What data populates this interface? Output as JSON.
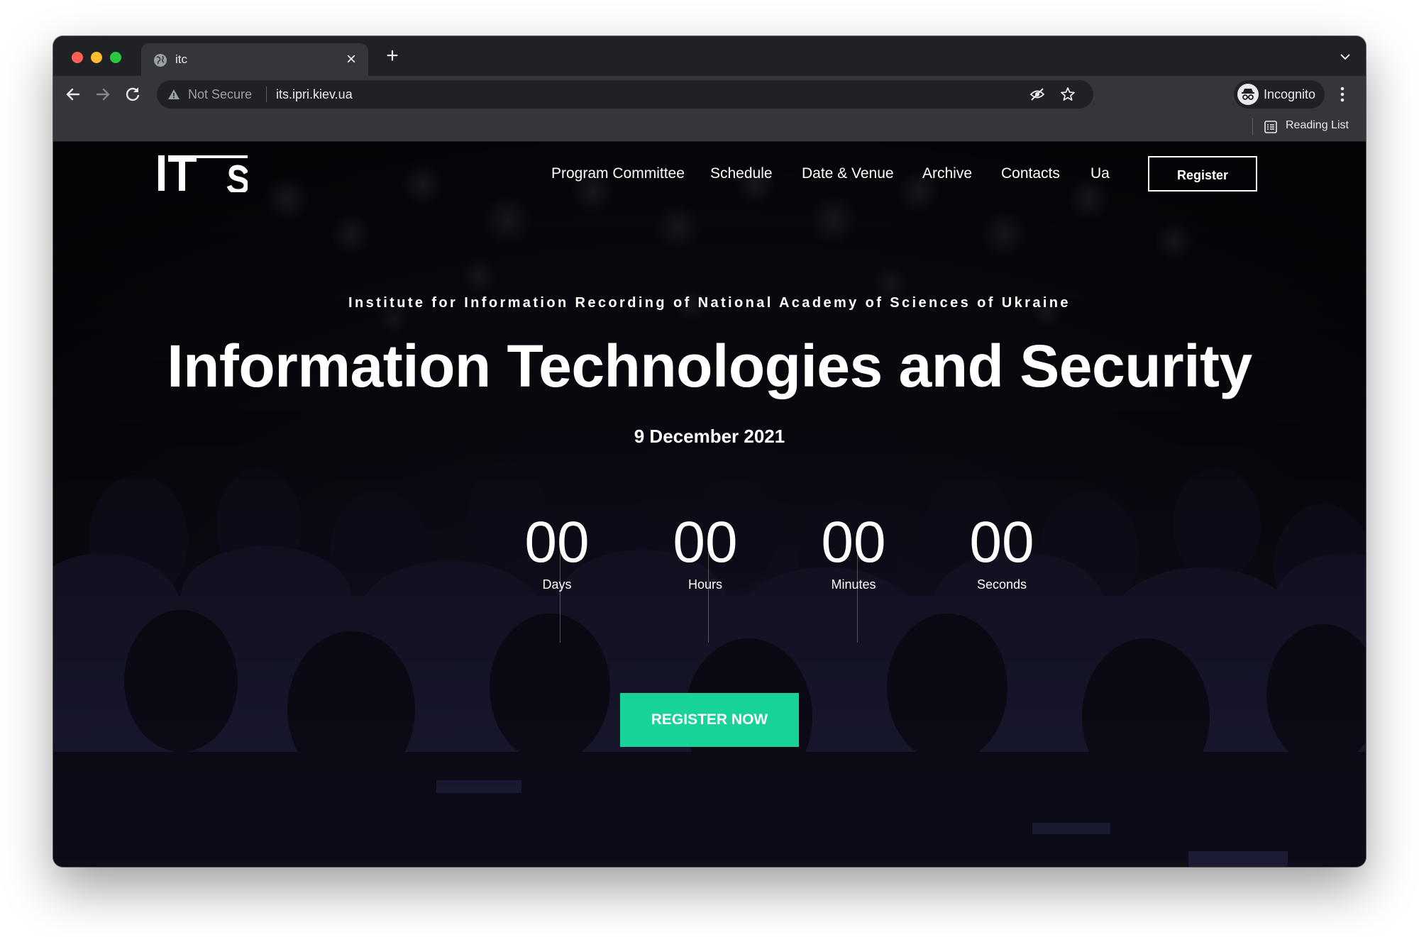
{
  "browser": {
    "tab_title": "itc",
    "security_label": "Not Secure",
    "url": "its.ipri.kiev.ua",
    "profile_label": "Incognito",
    "reading_list_label": "Reading List"
  },
  "site": {
    "logo_text": "IT S",
    "nav": [
      {
        "label": "Program Committee"
      },
      {
        "label": "Schedule"
      },
      {
        "label": "Date & Venue"
      },
      {
        "label": "Archive"
      },
      {
        "label": "Contacts"
      },
      {
        "label": "Ua"
      }
    ],
    "register_label": "Register"
  },
  "hero": {
    "institution": "Institute for Information Recording of National Academy of Sciences of Ukraine",
    "title": "Information Technologies and Security",
    "date": "9 December 2021",
    "countdown": [
      {
        "value": "00",
        "label": "Days"
      },
      {
        "value": "00",
        "label": "Hours"
      },
      {
        "value": "00",
        "label": "Minutes"
      },
      {
        "value": "00",
        "label": "Seconds"
      }
    ],
    "cta_label": "REGISTER NOW"
  },
  "colors": {
    "cta": "#17d397",
    "chrome_dark": "#202124",
    "chrome_toolbar": "#35363a"
  }
}
